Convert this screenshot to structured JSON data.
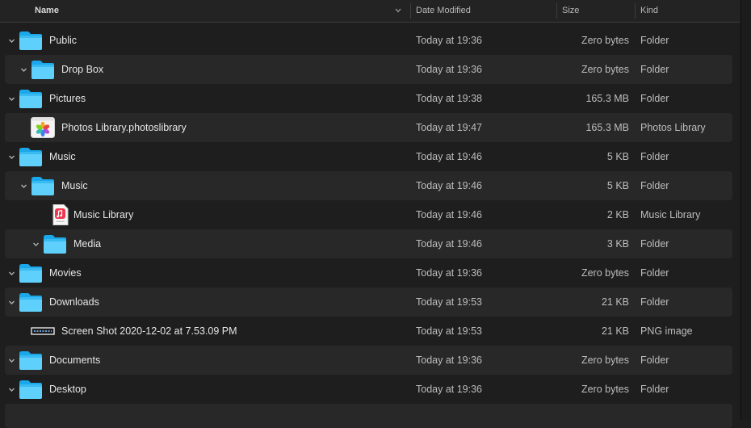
{
  "columns": {
    "name": "Name",
    "date_modified": "Date Modified",
    "size": "Size",
    "kind": "Kind"
  },
  "rows": [
    {
      "name": "Public",
      "date": "Today at 19:36",
      "size": "Zero bytes",
      "kind": "Folder",
      "depth": 0,
      "expanded": true,
      "icon": "folder-icon"
    },
    {
      "name": "Drop Box",
      "date": "Today at 19:36",
      "size": "Zero bytes",
      "kind": "Folder",
      "depth": 1,
      "expanded": true,
      "icon": "folder-icon"
    },
    {
      "name": "Pictures",
      "date": "Today at 19:38",
      "size": "165.3 MB",
      "kind": "Folder",
      "depth": 0,
      "expanded": true,
      "icon": "folder-icon"
    },
    {
      "name": "Photos Library.photoslibrary",
      "date": "Today at 19:47",
      "size": "165.3 MB",
      "kind": "Photos Library",
      "depth": 1,
      "expanded": false,
      "icon": "photos-library-icon"
    },
    {
      "name": "Music",
      "date": "Today at 19:46",
      "size": "5 KB",
      "kind": "Folder",
      "depth": 0,
      "expanded": true,
      "icon": "folder-icon"
    },
    {
      "name": "Music",
      "date": "Today at 19:46",
      "size": "5 KB",
      "kind": "Folder",
      "depth": 1,
      "expanded": true,
      "icon": "folder-icon"
    },
    {
      "name": "Music Library",
      "date": "Today at 19:46",
      "size": "2 KB",
      "kind": "Music Library",
      "depth": 2,
      "expanded": false,
      "icon": "music-library-icon"
    },
    {
      "name": "Media",
      "date": "Today at 19:46",
      "size": "3 KB",
      "kind": "Folder",
      "depth": 2,
      "expanded": true,
      "icon": "folder-icon"
    },
    {
      "name": "Movies",
      "date": "Today at 19:36",
      "size": "Zero bytes",
      "kind": "Folder",
      "depth": 0,
      "expanded": true,
      "icon": "folder-icon"
    },
    {
      "name": "Downloads",
      "date": "Today at 19:53",
      "size": "21 KB",
      "kind": "Folder",
      "depth": 0,
      "expanded": true,
      "icon": "folder-icon"
    },
    {
      "name": "Screen Shot 2020-12-02 at 7.53.09 PM",
      "date": "Today at 19:53",
      "size": "21 KB",
      "kind": "PNG image",
      "depth": 1,
      "expanded": false,
      "icon": "png-thumbnail-icon"
    },
    {
      "name": "Documents",
      "date": "Today at 19:36",
      "size": "Zero bytes",
      "kind": "Folder",
      "depth": 0,
      "expanded": true,
      "icon": "folder-icon"
    },
    {
      "name": "Desktop",
      "date": "Today at 19:36",
      "size": "Zero bytes",
      "kind": "Folder",
      "depth": 0,
      "expanded": true,
      "icon": "folder-icon"
    }
  ],
  "colors": {
    "folder_light": "#5fd0fb",
    "folder_dark": "#1aa8ea",
    "row_alt": "#282828",
    "background": "#1e1e1e"
  }
}
